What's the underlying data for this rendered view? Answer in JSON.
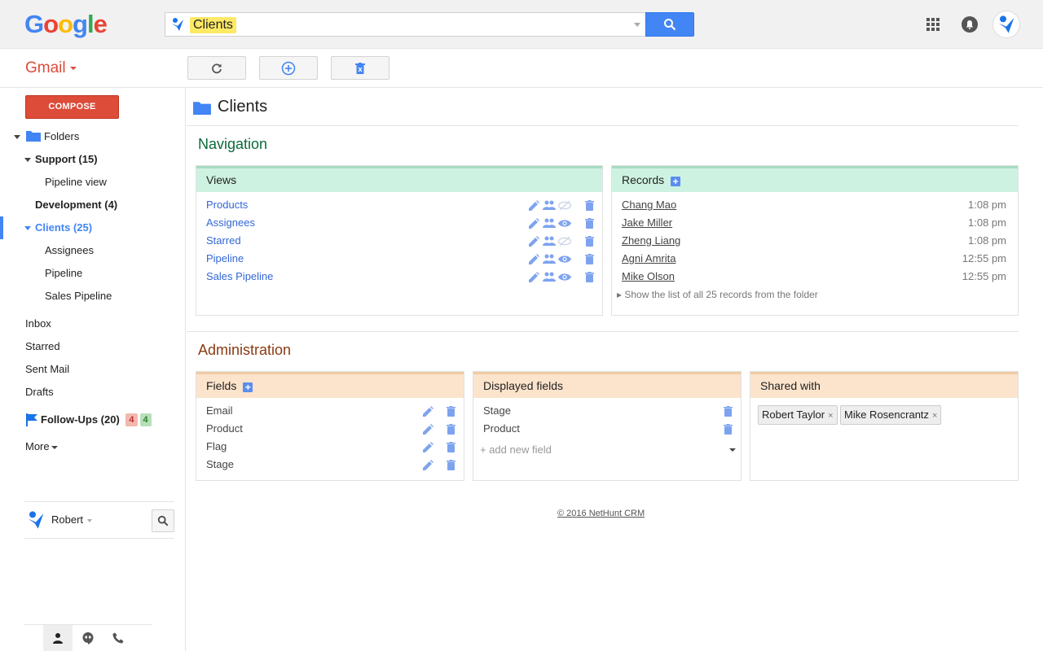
{
  "header": {
    "search_chip": "Clients",
    "colors": {
      "accent": "#4285f4",
      "compose": "#dd4b39"
    }
  },
  "subbar": {
    "product_label": "Gmail"
  },
  "sidebar": {
    "compose_label": "COMPOSE",
    "folders_label": "Folders",
    "support_label": "Support (15)",
    "pipeline_view_label": "Pipeline view",
    "development_label": "Development (4)",
    "clients_label": "Clients (25)",
    "clients_children": [
      "Assignees",
      "Pipeline",
      "Sales Pipeline"
    ],
    "mail": [
      "Inbox",
      "Starred",
      "Sent Mail",
      "Drafts"
    ],
    "followups_label": "Follow-Ups (20)",
    "followups_badge_red": "4",
    "followups_badge_green": "4",
    "more_label": "More",
    "user_name": "Robert"
  },
  "main": {
    "title": "Clients",
    "navigation_title": "Navigation",
    "views_title": "Views",
    "views": [
      "Products",
      "Assignees",
      "Starred",
      "Pipeline",
      "Sales Pipeline"
    ],
    "views_visible": [
      false,
      true,
      false,
      true,
      true
    ],
    "records_title": "Records",
    "records": [
      {
        "name": "Chang Mao",
        "time": "1:08 pm"
      },
      {
        "name": "Jake Miller",
        "time": "1:08 pm"
      },
      {
        "name": "Zheng Liang",
        "time": "1:08 pm"
      },
      {
        "name": "Agni Amrita",
        "time": "12:55 pm"
      },
      {
        "name": "Mike Olson",
        "time": "12:55 pm"
      }
    ],
    "records_show_all": "▸ Show the list of all 25 records from the folder",
    "administration_title": "Administration",
    "fields_title": "Fields",
    "fields": [
      "Email",
      "Product",
      "Flag",
      "Stage"
    ],
    "displayed_title": "Displayed fields",
    "displayed": [
      "Stage",
      "Product"
    ],
    "add_field_placeholder": "+ add new field",
    "shared_title": "Shared with",
    "shared": [
      "Robert Taylor",
      "Mike Rosencrantz"
    ],
    "footer": "© 2016 NetHunt CRM"
  }
}
